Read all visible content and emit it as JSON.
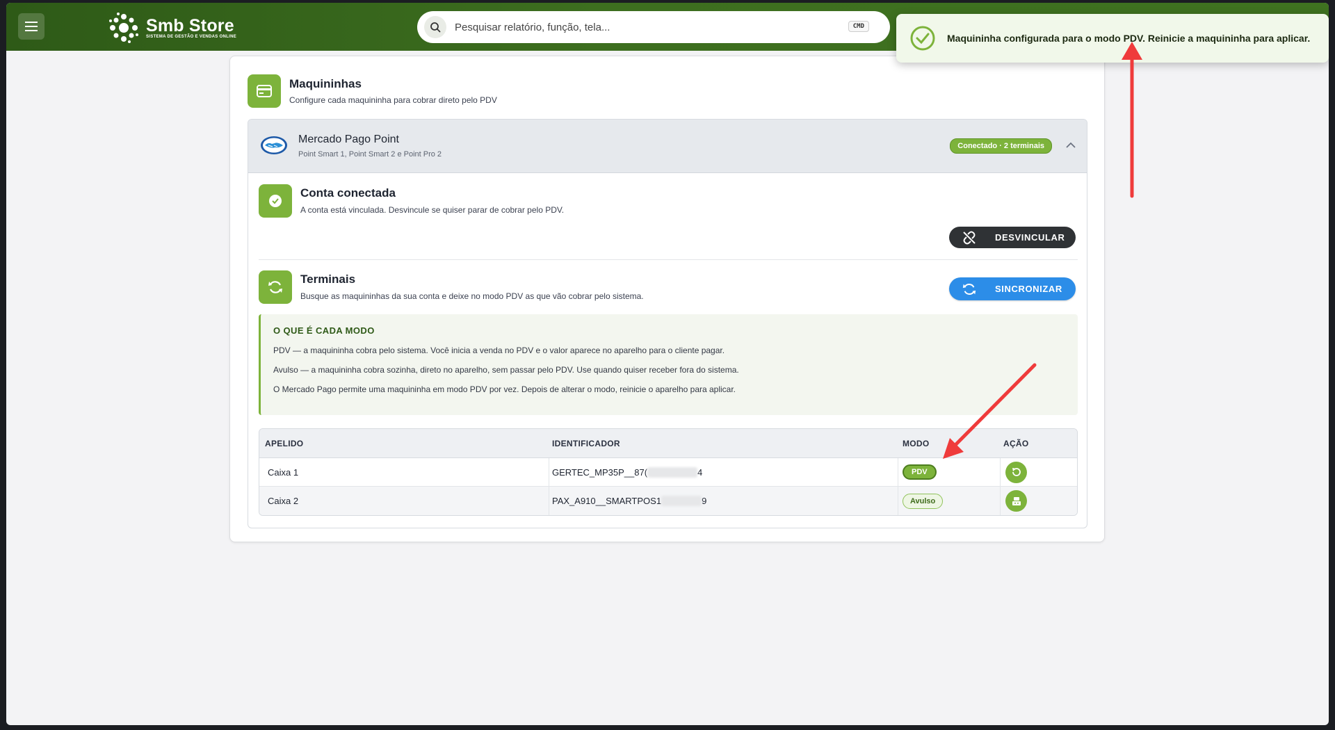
{
  "app": {
    "brand_name": "Smb Store",
    "brand_tagline": "SISTEMA DE GESTÃO E VENDAS ONLINE"
  },
  "search": {
    "placeholder": "Pesquisar relatório, função, tela...",
    "shortcut": "CMD"
  },
  "section": {
    "title": "Maquininhas",
    "subtitle": "Configure cada maquininha para cobrar direto pelo PDV"
  },
  "provider": {
    "name": "Mercado Pago Point",
    "models": "Point Smart 1, Point Smart 2 e Point Pro 2",
    "status_badge": "Conectado · 2 terminais"
  },
  "account": {
    "title": "Conta conectada",
    "description": "A conta está vinculada. Desvincule se quiser parar de cobrar pelo PDV.",
    "unlink_label": "DESVINCULAR"
  },
  "terminals": {
    "title": "Terminais",
    "description": "Busque as maquininhas da sua conta e deixe no modo PDV as que vão cobrar pelo sistema.",
    "sync_label": "SINCRONIZAR"
  },
  "info": {
    "heading": "O QUE É CADA MODO",
    "lines": [
      "PDV — a maquininha cobra pelo sistema. Você inicia a venda no PDV e o valor aparece no aparelho para o cliente pagar.",
      "Avulso — a maquininha cobra sozinha, direto no aparelho, sem passar pelo PDV. Use quando quiser receber fora do sistema.",
      "O Mercado Pago permite uma maquininha em modo PDV por vez. Depois de alterar o modo, reinicie o aparelho para aplicar."
    ]
  },
  "table": {
    "columns": [
      "APELIDO",
      "IDENTIFICADOR",
      "MODO",
      "AÇÃO"
    ],
    "rows": [
      {
        "nickname": "Caixa 1",
        "id_prefix": "GERTEC_MP35P__87(",
        "id_suffix": "4",
        "mode": "PDV"
      },
      {
        "nickname": "Caixa 2",
        "id_prefix": "PAX_A910__SMARTPOS1",
        "id_suffix": "9",
        "mode": "Avulso"
      }
    ]
  },
  "toast": {
    "message": "Maquininha configurada para o modo PDV. Reinicie a maquininha para aplicar."
  },
  "colors": {
    "brand_green": "#7db33b",
    "topbar_green": "#3d6e1f",
    "sync_blue": "#2c8de8",
    "annotation_red": "#ef3b3b"
  }
}
